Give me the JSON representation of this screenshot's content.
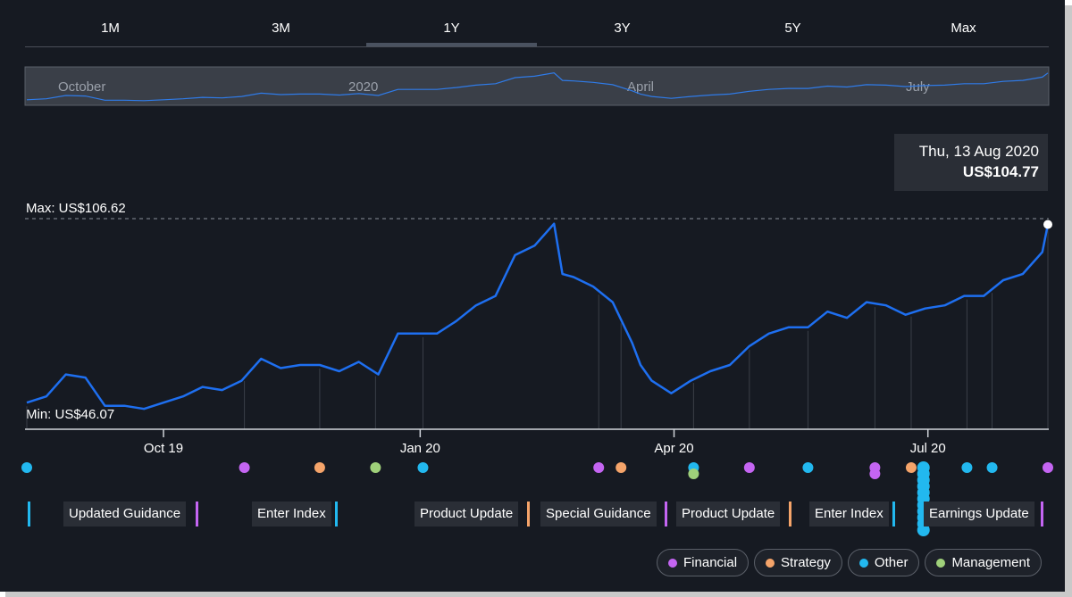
{
  "range_tabs": [
    "1M",
    "3M",
    "1Y",
    "3Y",
    "5Y",
    "Max"
  ],
  "active_tab": "1Y",
  "navigator": {
    "labels": [
      "October",
      "2020",
      "April",
      "July"
    ]
  },
  "tooltip": {
    "date": "Thu, 13 Aug 2020",
    "price": "US$104.77"
  },
  "max_label": "Max: US$106.62",
  "min_label": "Min: US$46.07",
  "colors": {
    "line": "#1e6ff0",
    "Financial": "#c465f2",
    "Strategy": "#f5a46a",
    "Other": "#22b8ef",
    "Management": "#9fd07a",
    "background": "#161a22"
  },
  "chart_data": {
    "type": "line",
    "title": "",
    "xlabel": "",
    "ylabel": "",
    "x_ticks": [
      "Oct 19",
      "Jan 20",
      "Apr 20",
      "Jul 20"
    ],
    "x_range": [
      "2019-08-13",
      "2020-08-13"
    ],
    "ylim": [
      40,
      112
    ],
    "max_value": 106.62,
    "min_value": 46.07,
    "series": [
      {
        "x": [
          "2019-08-13",
          "2019-08-20",
          "2019-08-27",
          "2019-09-03",
          "2019-09-10",
          "2019-09-17",
          "2019-09-24",
          "2019-10-01",
          "2019-10-08",
          "2019-10-15",
          "2019-10-22",
          "2019-10-29",
          "2019-11-05",
          "2019-11-12",
          "2019-11-19",
          "2019-11-26",
          "2019-12-03",
          "2019-12-10",
          "2019-12-17",
          "2019-12-24",
          "2019-12-31",
          "2020-01-07",
          "2020-01-14",
          "2020-01-21",
          "2020-01-28",
          "2020-02-04",
          "2020-02-11",
          "2020-02-18",
          "2020-02-21",
          "2020-02-25",
          "2020-03-03",
          "2020-03-10",
          "2020-03-17",
          "2020-03-20",
          "2020-03-24",
          "2020-03-31",
          "2020-04-07",
          "2020-04-14",
          "2020-04-21",
          "2020-04-28",
          "2020-05-05",
          "2020-05-12",
          "2020-05-19",
          "2020-05-26",
          "2020-06-02",
          "2020-06-09",
          "2020-06-16",
          "2020-06-23",
          "2020-06-30",
          "2020-07-07",
          "2020-07-14",
          "2020-07-21",
          "2020-07-28",
          "2020-08-04",
          "2020-08-11",
          "2020-08-13"
        ],
        "values": [
          48,
          50,
          57,
          56,
          47,
          47,
          46,
          48,
          50,
          53,
          52,
          55,
          62,
          59,
          60,
          60,
          58,
          61,
          57,
          70,
          70,
          70,
          74,
          79,
          82,
          95,
          98,
          105,
          89,
          88,
          85,
          80,
          67,
          60,
          55,
          51,
          55,
          58,
          60,
          66,
          70,
          72,
          72,
          77,
          75,
          80,
          79,
          76,
          78,
          79,
          82,
          82,
          87,
          89,
          96,
          104.77
        ]
      }
    ],
    "events": [
      {
        "date": "2019-08-13",
        "category": "Other"
      },
      {
        "date": "2019-10-30",
        "category": "Financial",
        "label": "Updated Guidance"
      },
      {
        "date": "2019-11-26",
        "category": "Strategy"
      },
      {
        "date": "2019-12-16",
        "category": "Management"
      },
      {
        "date": "2020-01-02",
        "category": "Other",
        "label": "Enter Index"
      },
      {
        "date": "2020-03-05",
        "category": "Financial"
      },
      {
        "date": "2020-03-13",
        "category": "Strategy",
        "label": "Product Update"
      },
      {
        "date": "2020-04-08",
        "category": "Other"
      },
      {
        "date": "2020-04-08",
        "category": "Management"
      },
      {
        "date": "2020-04-28",
        "category": "Financial",
        "label": "Special Guidance"
      },
      {
        "date": "2020-05-19",
        "category": "Other"
      },
      {
        "date": "2020-06-12",
        "category": "Financial"
      },
      {
        "date": "2020-06-12",
        "category": "Financial"
      },
      {
        "date": "2020-06-25",
        "category": "Strategy",
        "label": "Product Update"
      },
      {
        "date": "2020-07-15",
        "category": "Other",
        "label": "Enter Index"
      },
      {
        "date": "2020-07-24",
        "category": "Other",
        "label": "Earnings Update"
      },
      {
        "date": "2020-08-13",
        "category": "Financial"
      }
    ]
  },
  "event_labels": [
    {
      "text": "Updated Guidance",
      "category": "Financial"
    },
    {
      "text": "Enter Index",
      "category": "Other"
    },
    {
      "text": "Product Update",
      "category": "Strategy"
    },
    {
      "text": "Special Guidance",
      "category": "Financial"
    },
    {
      "text": "Product Update",
      "category": "Strategy"
    },
    {
      "text": "Enter Index",
      "category": "Other"
    },
    {
      "text": "Earnings Update",
      "category": "Financial"
    }
  ],
  "legend": [
    "Financial",
    "Strategy",
    "Other",
    "Management"
  ]
}
